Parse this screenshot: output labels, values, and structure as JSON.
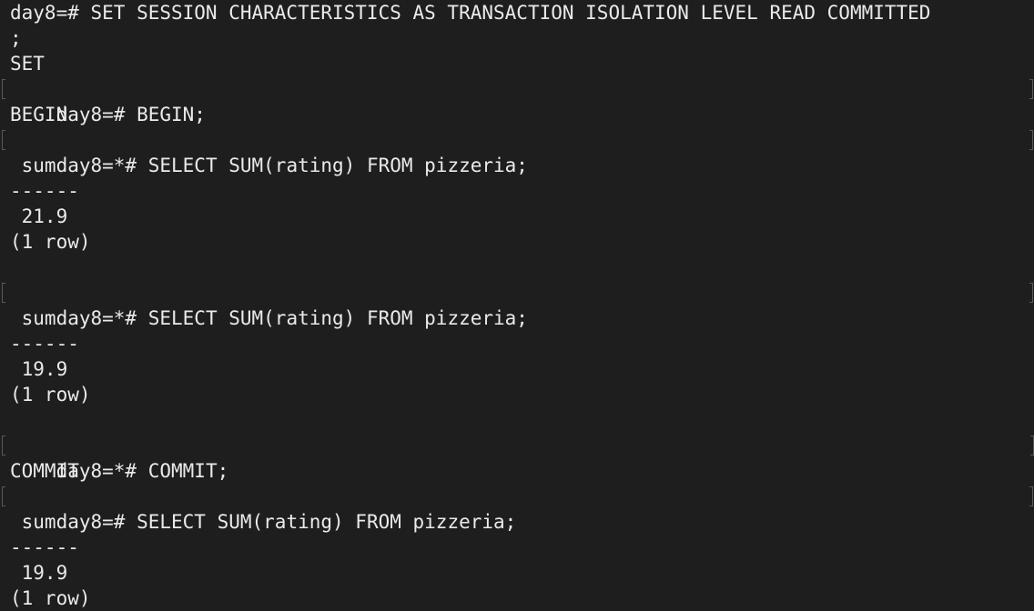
{
  "terminal": {
    "lines": [
      "day8=# SET SESSION CHARACTERISTICS AS TRANSACTION ISOLATION LEVEL READ COMMITTED",
      ";",
      "SET",
      "day8=# BEGIN;",
      "BEGIN",
      "day8=*# SELECT SUM(rating) FROM pizzeria;",
      " sum",
      "------",
      " 21.9",
      "(1 row)",
      "",
      "day8=*# SELECT SUM(rating) FROM pizzeria;",
      " sum",
      "------",
      " 19.9",
      "(1 row)",
      "",
      "day8=*# COMMIT;",
      "COMMIT",
      "day8=# SELECT SUM(rating) FROM pizzeria;",
      " sum",
      "------",
      " 19.9",
      "(1 row)"
    ]
  },
  "colors": {
    "background": "#1e1e1e",
    "text": "#eaeaea",
    "mark": "#5a5a5a"
  }
}
